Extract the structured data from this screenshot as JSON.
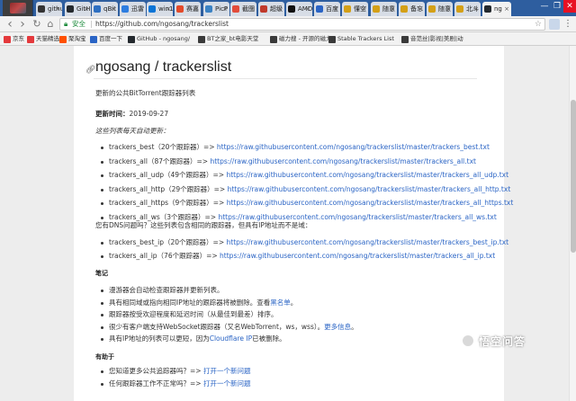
{
  "tabs": [
    {
      "label": "githu",
      "color": "#333333"
    },
    {
      "label": "GitHu",
      "color": "#24292e"
    },
    {
      "label": "qBit",
      "color": "#2d6fc1"
    },
    {
      "label": "迅雷",
      "color": "#2d7de0"
    },
    {
      "label": "win1",
      "color": "#0a74d6"
    },
    {
      "label": "赛嘉",
      "color": "#e34a2a"
    },
    {
      "label": "PicP",
      "color": "#3b82c4"
    },
    {
      "label": "截图",
      "color": "#e24c3a"
    },
    {
      "label": "超级",
      "color": "#c0392b"
    },
    {
      "label": "AMD",
      "color": "#111111"
    },
    {
      "label": "百度",
      "color": "#2a64c5"
    },
    {
      "label": "懂空",
      "color": "#d4a017"
    },
    {
      "label": "随意",
      "color": "#d4a017"
    },
    {
      "label": "备忘",
      "color": "#d4a017"
    },
    {
      "label": "随意",
      "color": "#d4a017"
    },
    {
      "label": "北斗",
      "color": "#d4a017"
    },
    {
      "label": "ng",
      "color": "#24292e"
    }
  ],
  "window_controls": [
    "—",
    "❐",
    "✕"
  ],
  "toolbar": {
    "back": "‹",
    "forward": "›",
    "reload": "↻",
    "home": "⌂",
    "secure_label": "安全",
    "url": "https://github.com/ngosang/trackerslist",
    "menu": "⋮"
  },
  "bookmarks": [
    {
      "label": "京东",
      "color": "#e4393c"
    },
    {
      "label": "天猫精选",
      "color": "#e4393c"
    },
    {
      "label": "聚淘宝",
      "color": "#ff5000"
    },
    {
      "label": "百度一下",
      "color": "#2a64c5"
    },
    {
      "label": "GitHub - ngosang/",
      "color": "#24292e"
    },
    {
      "label": "BT之家_bt电影天堂",
      "color": "#3a3a3a"
    },
    {
      "label": "磁力搜 - 开源的磁力",
      "color": "#3a3a3a"
    },
    {
      "label": "Stable Trackers List",
      "color": "#3a3a3a"
    },
    {
      "label": "音范丝|影视|美剧|动",
      "color": "#3a3a3a"
    }
  ],
  "page": {
    "title": "ngosang / trackerslist",
    "subtitle": "更新的公共BitTorrent跟踪器列表",
    "update_label": "更新时间：",
    "update_date": "2019-09-27",
    "auto_update_note": "这些列表每天自动更新：",
    "lists": [
      {
        "name": "trackers_best",
        "count": "（20个跟踪器）=> ",
        "url": "https://raw.githubusercontent.com/ngosang/trackerslist/master/trackers_best.txt"
      },
      {
        "name": "trackers_all",
        "count": "（87个跟踪器）=> ",
        "url": "https://raw.githubusercontent.com/ngosang/trackerslist/master/trackers_all.txt"
      },
      {
        "name": "trackers_all_udp",
        "count": "（49个跟踪器）=> ",
        "url": "https://raw.githubusercontent.com/ngosang/trackerslist/master/trackers_all_udp.txt"
      },
      {
        "name": "trackers_all_http",
        "count": "（29个跟踪器）=> ",
        "url": "https://raw.githubusercontent.com/ngosang/trackerslist/master/trackers_all_http.txt"
      },
      {
        "name": "trackers_all_https",
        "count": "（9个跟踪器）=> ",
        "url": "https://raw.githubusercontent.com/ngosang/trackerslist/master/trackers_all_https.txt"
      },
      {
        "name": "trackers_all_ws",
        "count": "（3个跟踪器）=> ",
        "url": "https://raw.githubusercontent.com/ngosang/trackerslist/master/trackers_all_ws.txt"
      }
    ],
    "dns_question": "您有DNS问题吗？这些列表包含相同的跟踪器，但具有IP地址而不是域：",
    "ip_lists": [
      {
        "name": "trackers_best_ip",
        "count": "（20个跟踪器）=> ",
        "url": "https://raw.githubusercontent.com/ngosang/trackerslist/master/trackers_best_ip.txt"
      },
      {
        "name": "trackers_all_ip",
        "count": "（76个跟踪器）=> ",
        "url": "https://raw.githubusercontent.com/ngosang/trackerslist/master/trackers_all_ip.txt"
      }
    ],
    "notes_heading": "笔记",
    "notes": [
      {
        "text": "漫游器会自动检查跟踪器并更新列表。",
        "link": "",
        "tail": ""
      },
      {
        "text": "具有相同域或指向相同IP地址的跟踪器将被删除。查看",
        "link": "黑名单",
        "tail": "。"
      },
      {
        "text": "跟踪器按受欢迎程度和延迟时间（从最佳到最差）排序。",
        "link": "",
        "tail": ""
      },
      {
        "text": "很少有客户端支持WebSocket跟踪器（又名WebTorrent，ws，wss）。",
        "link": "更多信息",
        "tail": "。"
      },
      {
        "text": "具有IP地址的列表可以更短，因为",
        "link": "Cloudflare IP",
        "tail": "已被删除。"
      }
    ],
    "help_heading": "有助于",
    "help_items": [
      {
        "text": "您知道更多公共追踪器吗？=> ",
        "link": "打开一个新问题"
      },
      {
        "text": "任何跟踪器工作不正常吗？=> ",
        "link": "打开一个新问题"
      }
    ]
  },
  "watermark": {
    "text": "悟空问答"
  },
  "colors": {
    "link": "#2a64c5",
    "tabstrip": "#2e5e9f"
  }
}
